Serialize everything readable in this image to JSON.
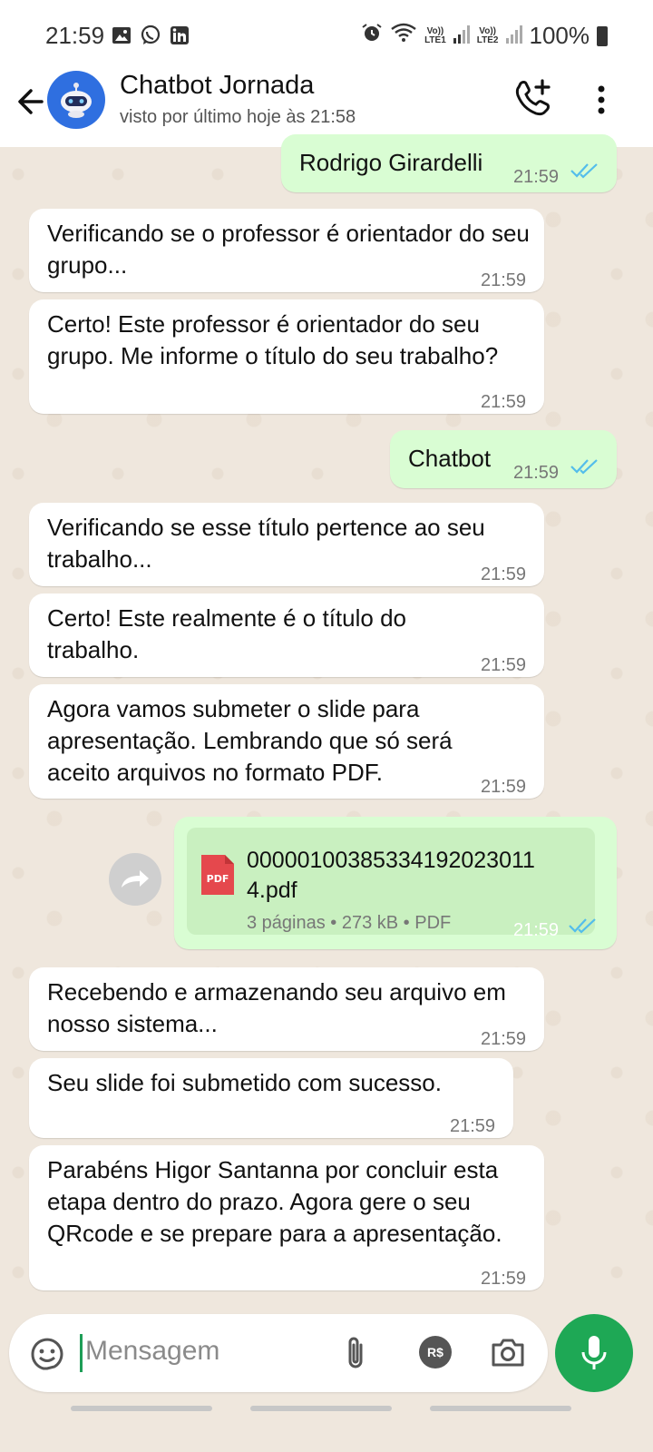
{
  "status_bar": {
    "time": "21:59",
    "left_icons": [
      "image-icon",
      "whatsapp-icon",
      "linkedin-icon"
    ],
    "signal_labels": [
      "Vo))\nLTE1",
      "Vo))\nLTE2"
    ],
    "battery": "100%"
  },
  "header": {
    "title": "Chatbot Jornada",
    "subtitle": "visto por último hoje às 21:58",
    "icons": [
      "back-arrow-icon",
      "bot-avatar",
      "add-call-icon",
      "more-vert-icon"
    ]
  },
  "messages": [
    {
      "dir": "out",
      "text": "Rodrigo Girardelli",
      "time": "21:59",
      "status": "read"
    },
    {
      "dir": "in",
      "text": "Verificando se o professor é orientador do seu grupo...",
      "time": "21:59"
    },
    {
      "dir": "in",
      "text": "Certo! Este professor é orientador do seu grupo. Me informe o título do seu trabalho?",
      "time": "21:59"
    },
    {
      "dir": "out",
      "text": "Chatbot",
      "time": "21:59",
      "status": "read"
    },
    {
      "dir": "in",
      "text": "Verificando se esse título pertence ao seu trabalho...",
      "time": "21:59"
    },
    {
      "dir": "in",
      "text": "Certo! Este realmente é o título do trabalho.",
      "time": "21:59"
    },
    {
      "dir": "in",
      "text": "Agora vamos submeter o slide para apresentação. Lembrando que só será aceito arquivos no formato PDF.",
      "time": "21:59"
    },
    {
      "dir": "out",
      "type": "document",
      "file_name": "00000100385334192023011 4.pdf",
      "meta": "3 páginas • 273 kB • PDF",
      "file_badge": "PDF",
      "time": "21:59",
      "status": "read"
    },
    {
      "dir": "in",
      "text": "Recebendo e armazenando seu arquivo em nosso sistema...",
      "time": "21:59"
    },
    {
      "dir": "in",
      "text": "Seu slide foi submetido com sucesso.",
      "time": "21:59"
    },
    {
      "dir": "in",
      "text": "Parabéns Higor Santanna por concluir esta etapa dentro do prazo. Agora gere o seu QRcode e se prepare para a apresentação.",
      "time": "21:59"
    }
  ],
  "composer": {
    "placeholder": "Mensagem",
    "currency_badge": "R$",
    "icons": [
      "sticker-icon",
      "attach-icon",
      "payment-icon",
      "camera-icon",
      "mic-icon"
    ]
  },
  "colors": {
    "outgoing_bubble": "#d9fdd3",
    "incoming_bubble": "#ffffff",
    "read_ticks": "#53bdeb",
    "accent_green": "#1ea855",
    "avatar_blue": "#2f6fe0"
  }
}
